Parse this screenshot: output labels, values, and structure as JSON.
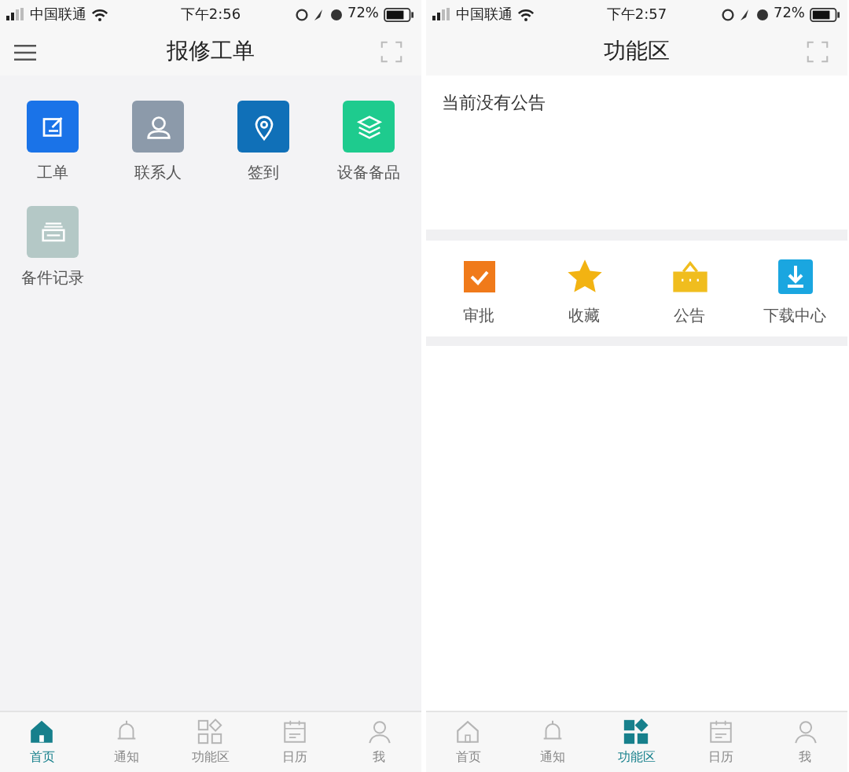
{
  "screens": [
    {
      "status_bar": {
        "carrier": "中国联通",
        "time": "下午2:56",
        "battery": "72%"
      },
      "header": {
        "title": "报修工单",
        "menu": true
      },
      "grid": [
        {
          "label": "工单",
          "color": "#1a73e8"
        },
        {
          "label": "联系人",
          "color": "#8c9aaa"
        },
        {
          "label": "签到",
          "color": "#1070b8"
        },
        {
          "label": "设备备品",
          "color": "#1ecb8e"
        },
        {
          "label": "备件记录",
          "color": "#b4c8c6"
        }
      ],
      "tabs": [
        {
          "label": "首页",
          "selected": true
        },
        {
          "label": "通知",
          "selected": false
        },
        {
          "label": "功能区",
          "selected": false
        },
        {
          "label": "日历",
          "selected": false
        },
        {
          "label": "我",
          "selected": false
        }
      ]
    },
    {
      "status_bar": {
        "carrier": "中国联通",
        "time": "下午2:57",
        "battery": "72%"
      },
      "header": {
        "title": "功能区",
        "menu": false
      },
      "notice": "当前没有公告",
      "functions": [
        {
          "label": "审批",
          "color": "#f07a1a"
        },
        {
          "label": "收藏",
          "color": "#f2b312"
        },
        {
          "label": "公告",
          "color": "#f0bd1e"
        },
        {
          "label": "下载中心",
          "color": "#1aa6e0"
        }
      ],
      "tabs": [
        {
          "label": "首页",
          "selected": false
        },
        {
          "label": "通知",
          "selected": false
        },
        {
          "label": "功能区",
          "selected": true
        },
        {
          "label": "日历",
          "selected": false
        },
        {
          "label": "我",
          "selected": false
        }
      ]
    }
  ]
}
